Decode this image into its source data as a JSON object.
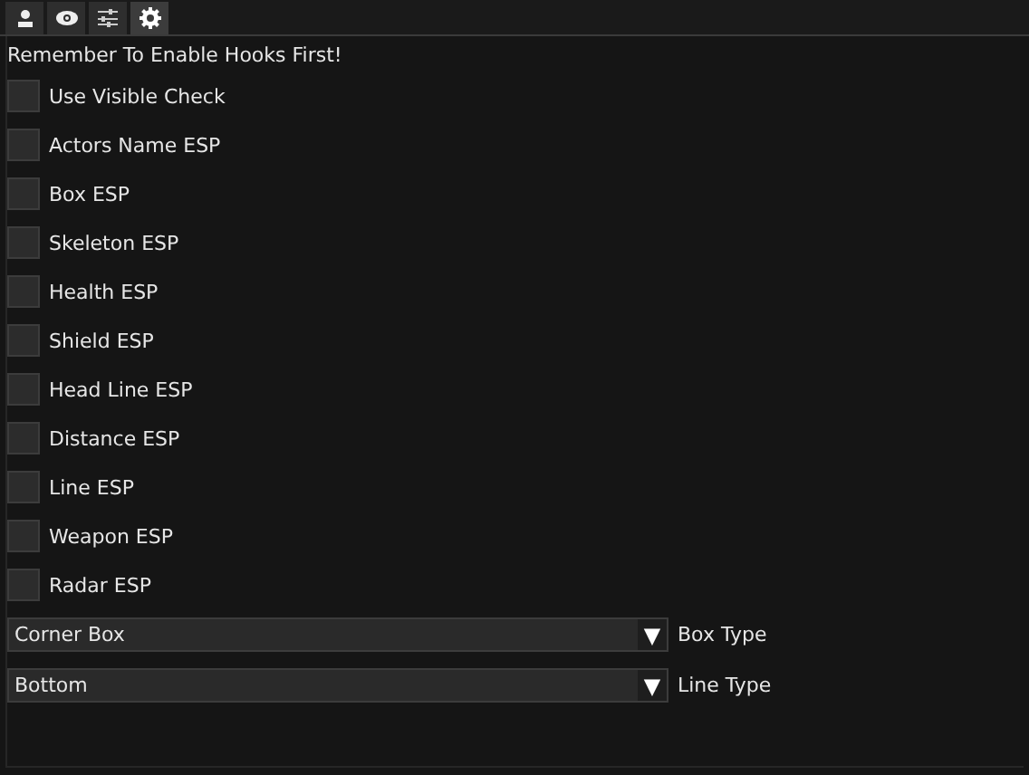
{
  "tabs": [
    {
      "kind": "person",
      "selected": false
    },
    {
      "kind": "eye",
      "selected": false
    },
    {
      "kind": "sliders",
      "selected": false
    },
    {
      "kind": "gear",
      "selected": true
    }
  ],
  "notice": "Remember To Enable Hooks First!",
  "checkboxes": [
    {
      "label": "Use Visible Check",
      "checked": false
    },
    {
      "label": "Actors Name ESP",
      "checked": false
    },
    {
      "label": "Box ESP",
      "checked": false
    },
    {
      "label": "Skeleton ESP",
      "checked": false
    },
    {
      "label": "Health ESP",
      "checked": false
    },
    {
      "label": "Shield ESP",
      "checked": false
    },
    {
      "label": "Head Line ESP",
      "checked": false
    },
    {
      "label": "Distance ESP",
      "checked": false
    },
    {
      "label": "Line ESP",
      "checked": false
    },
    {
      "label": "Weapon ESP",
      "checked": false
    },
    {
      "label": "Radar ESP",
      "checked": false
    }
  ],
  "dropdowns": [
    {
      "value": "Corner Box",
      "arrow": "▼",
      "label": "Box Type"
    },
    {
      "value": "Bottom",
      "arrow": "▼",
      "label": "Line Type"
    }
  ]
}
